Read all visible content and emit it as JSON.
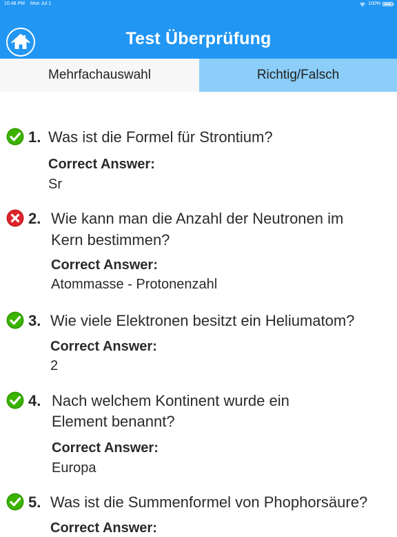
{
  "status_bar": {
    "time": "10:48 PM",
    "date": "Mon Jul 1",
    "battery": "100%",
    "icons": [
      "wifi-icon",
      "battery-icon"
    ]
  },
  "header": {
    "title": "Test Überprüfung",
    "home_icon": "home-icon"
  },
  "tabs": [
    {
      "label": "Mehrfachauswahl",
      "selected": true
    },
    {
      "label": "Richtig/Falsch",
      "selected": false
    }
  ],
  "questions": [
    {
      "number": "1.",
      "text": "Was ist die Formel für Strontium?",
      "answer_label": "Correct Answer:",
      "answer": "Sr",
      "status": "correct",
      "status_icon": "checkmark-icon"
    },
    {
      "number": "2.",
      "text_line1": "Wie kann man die Anzahl der Neutronen im",
      "text_line2": "Kern bestimmen?",
      "answer_label": "Correct Answer:",
      "answer": "Atommasse - Protonenzahl",
      "status": "wrong",
      "status_icon": "x-mark-icon"
    },
    {
      "number": "3.",
      "text": "Wie viele Elektronen besitzt ein Heliumatom?",
      "answer_label": "Correct Answer:",
      "answer": "2",
      "status": "correct",
      "status_icon": "checkmark-icon"
    },
    {
      "number": "4.",
      "text_line1": "Nach welchem Kontinent wurde ein",
      "text_line2": "Element benannt?",
      "answer_label": "Correct Answer:",
      "answer": "Europa",
      "status": "correct",
      "status_icon": "checkmark-icon"
    },
    {
      "number": "5.",
      "text": "Was ist die Summenformel von Phophorsäure?",
      "answer_label": "Correct Answer:",
      "status": "correct",
      "status_icon": "checkmark-icon"
    }
  ],
  "colors": {
    "header_blue": "#2196f3",
    "tab_selected": "#f7f7f7",
    "tab_unselected": "#8ccdf9",
    "correct_green": "#3bb300",
    "wrong_red": "#e0242b"
  }
}
